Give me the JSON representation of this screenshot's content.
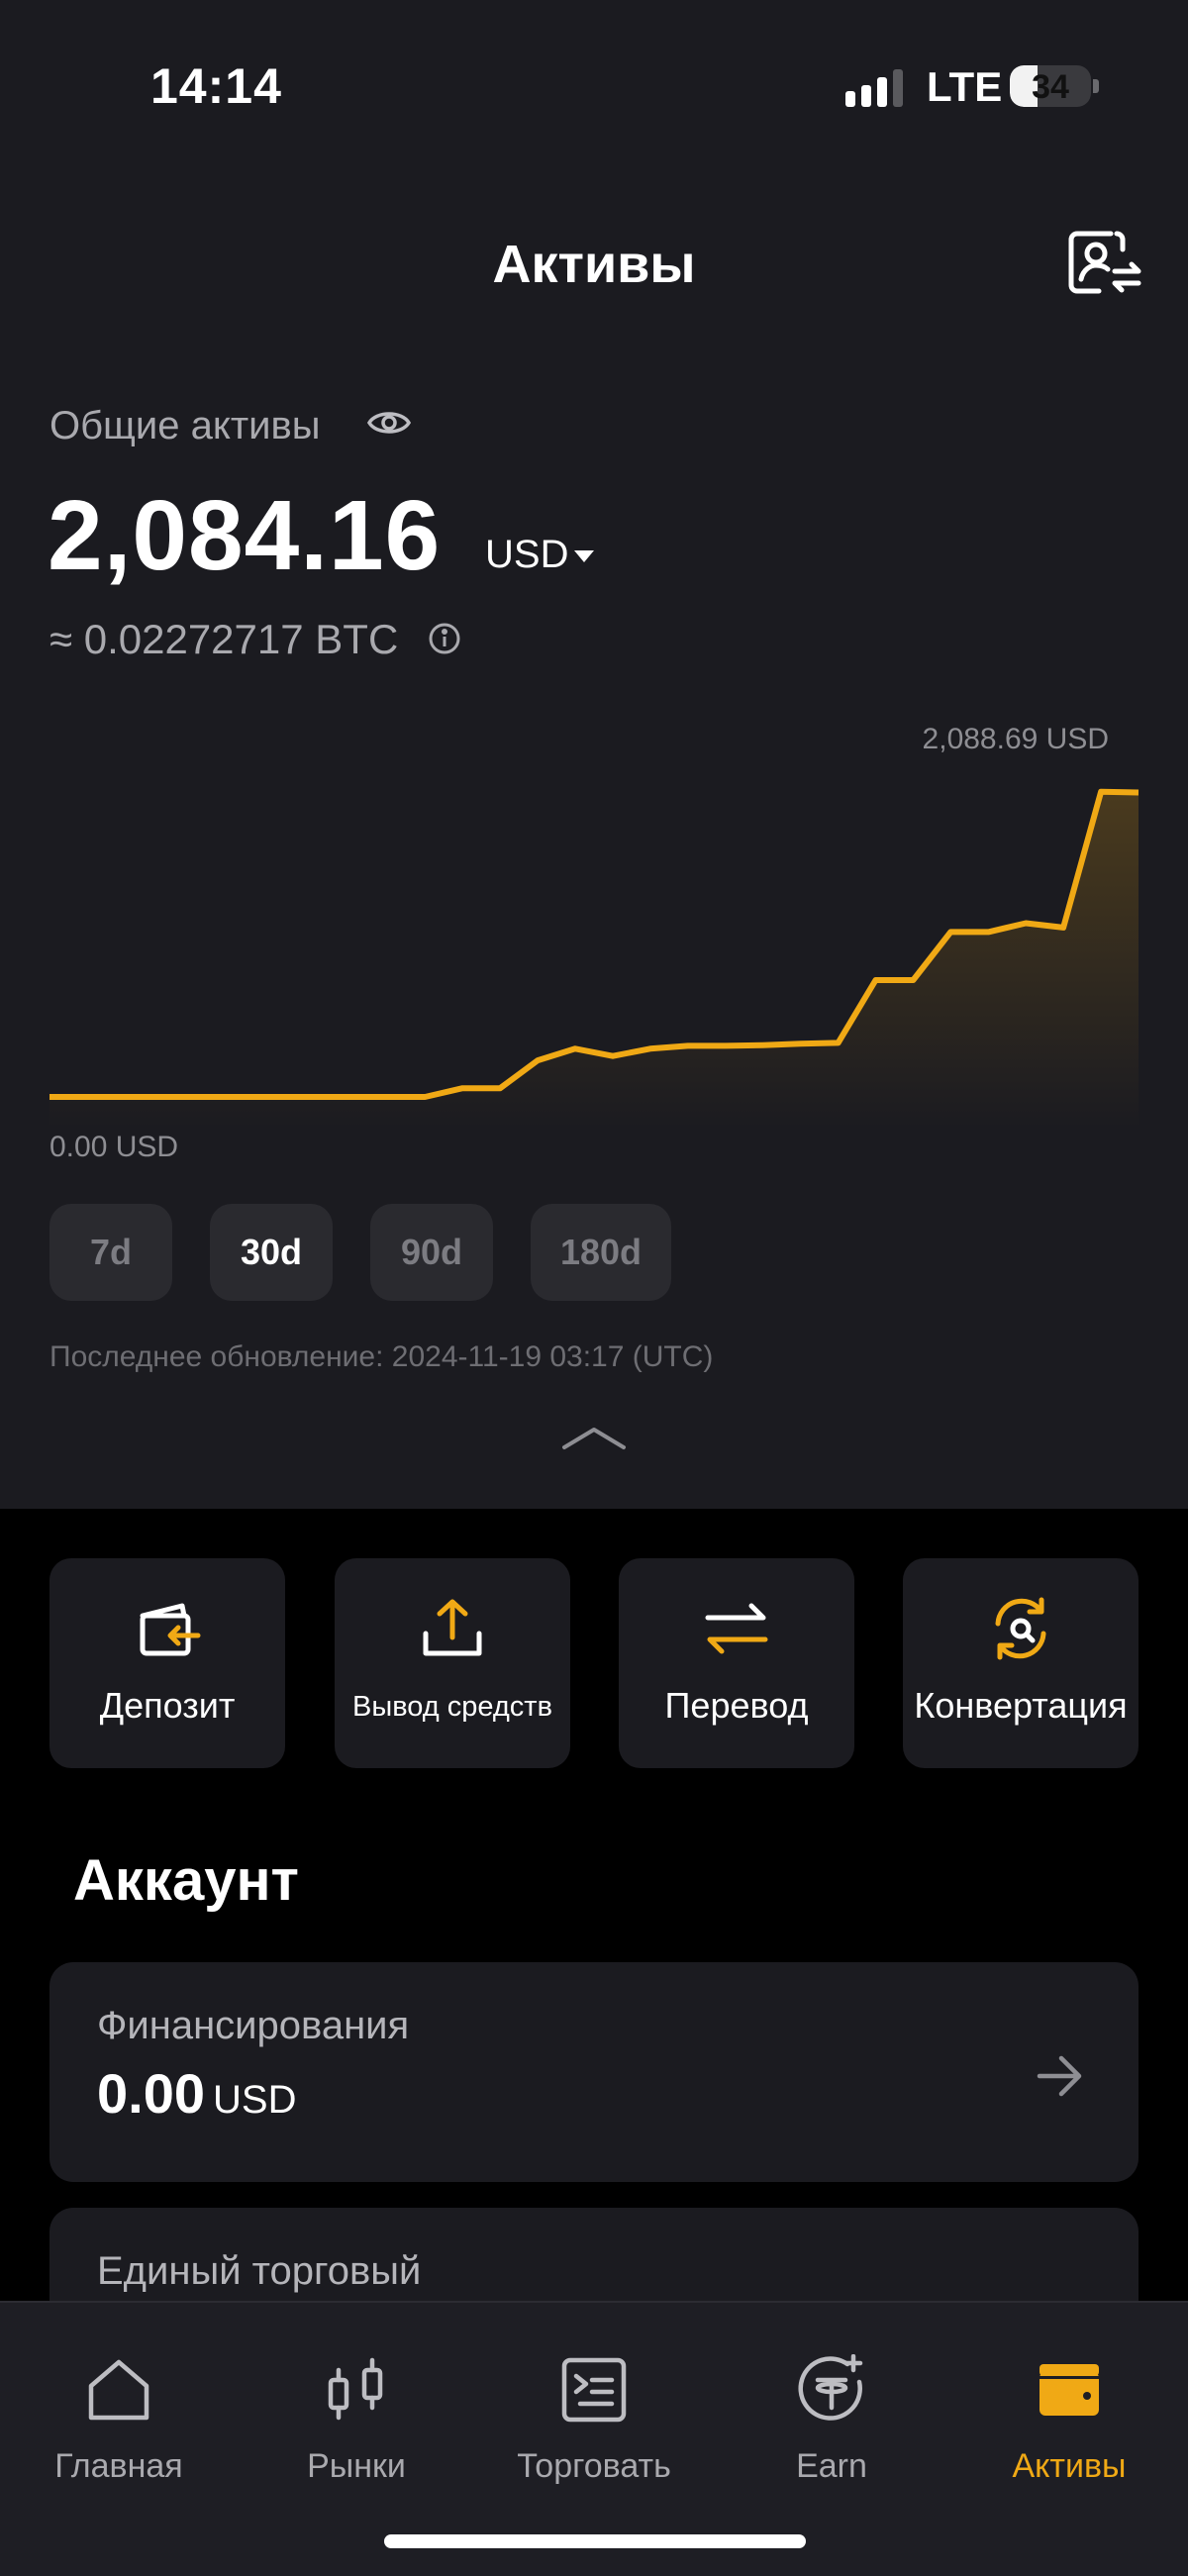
{
  "status_bar": {
    "time": "14:14",
    "network": "LTE",
    "battery": 34
  },
  "header": {
    "title": "Активы"
  },
  "totals": {
    "label": "Общие активы",
    "value": "2,084.16",
    "currency": "USD",
    "btc_equivalent": "≈ 0.02272717 BTC"
  },
  "chart_data": {
    "type": "area",
    "max_label": "2,088.69 USD",
    "min_label": "0.00 USD",
    "ylim": [
      0,
      2088.69
    ],
    "line_color": "#f0a915",
    "values": [
      0,
      0,
      0,
      0,
      0,
      0,
      0,
      0,
      0,
      0,
      0,
      60,
      60,
      250,
      330,
      280,
      330,
      350,
      350,
      355,
      365,
      370,
      800,
      800,
      1130,
      1130,
      1190,
      1160,
      2090,
      2085
    ]
  },
  "ranges": [
    {
      "label": "7d",
      "active": false
    },
    {
      "label": "30d",
      "active": true
    },
    {
      "label": "90d",
      "active": false
    },
    {
      "label": "180d",
      "active": false
    }
  ],
  "last_update": "Последнее обновление: 2024-11-19 03:17 (UTC)",
  "actions": [
    {
      "label": "Депозит",
      "icon": "deposit-icon"
    },
    {
      "label": "Вывод средств",
      "icon": "withdraw-icon"
    },
    {
      "label": "Перевод",
      "icon": "transfer-icon"
    },
    {
      "label": "Конвертация",
      "icon": "convert-icon"
    }
  ],
  "accounts_section": {
    "title": "Аккаунт"
  },
  "accounts": [
    {
      "name": "Финансирования",
      "balance": "0.00",
      "currency": "USD"
    },
    {
      "name": "Единый торговый",
      "balance": "",
      "currency": ""
    }
  ],
  "nav": [
    {
      "label": "Главная",
      "icon": "home-icon",
      "active": false
    },
    {
      "label": "Рынки",
      "icon": "markets-icon",
      "active": false
    },
    {
      "label": "Торговать",
      "icon": "trade-icon",
      "active": false
    },
    {
      "label": "Earn",
      "icon": "earn-icon",
      "active": false
    },
    {
      "label": "Активы",
      "icon": "wallet-icon",
      "active": true
    }
  ],
  "colors": {
    "accent": "#f0a915",
    "background": "#000000",
    "panel": "#1b1b20"
  }
}
